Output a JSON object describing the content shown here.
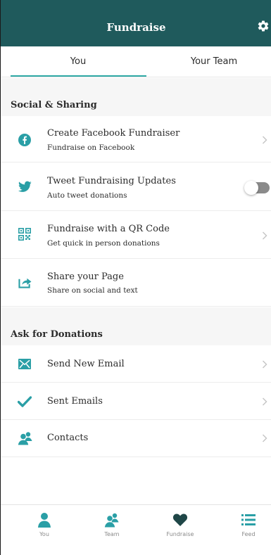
{
  "header": {
    "title": "Fundraise",
    "settings_icon": "gear-icon"
  },
  "tabs": [
    {
      "label": "You",
      "selected": true
    },
    {
      "label": "Your Team",
      "selected": false
    }
  ],
  "sections": [
    {
      "heading": "Social & Sharing",
      "rows": [
        {
          "title": "Create Facebook Fundraiser",
          "subtitle": "Fundraise on Facebook",
          "icon": "facebook-icon",
          "trailing": "chevron"
        },
        {
          "title": "Tweet Fundraising Updates",
          "subtitle": "Auto tweet donations",
          "icon": "twitter-icon",
          "trailing": "toggle",
          "toggle_on": false
        },
        {
          "title": "Fundraise with a QR Code",
          "subtitle": "Get quick in person donations",
          "icon": "qr-code-icon",
          "trailing": "chevron"
        },
        {
          "title": "Share your Page",
          "subtitle": "Share on social and text",
          "icon": "share-icon",
          "trailing": "none"
        }
      ]
    },
    {
      "heading": "Ask for Donations",
      "rows": [
        {
          "title": "Send New Email",
          "icon": "mail-icon",
          "trailing": "chevron"
        },
        {
          "title": "Sent Emails",
          "icon": "checkmark-icon",
          "trailing": "chevron"
        },
        {
          "title": "Contacts",
          "icon": "contacts-icon",
          "trailing": "chevron"
        }
      ]
    }
  ],
  "tabbar": [
    {
      "label": "You",
      "icon": "person-icon"
    },
    {
      "label": "Team",
      "icon": "team-icon"
    },
    {
      "label": "Fundraise",
      "icon": "heart-icon",
      "active": true
    },
    {
      "label": "Feed",
      "icon": "list-icon"
    }
  ],
  "colors": {
    "header_bg": "#1f5a5c",
    "accent": "#2fa9a5",
    "icon_teal": "#2a9fa6",
    "text": "#2b2b2b",
    "toggle_off": "#8b8b8b"
  }
}
